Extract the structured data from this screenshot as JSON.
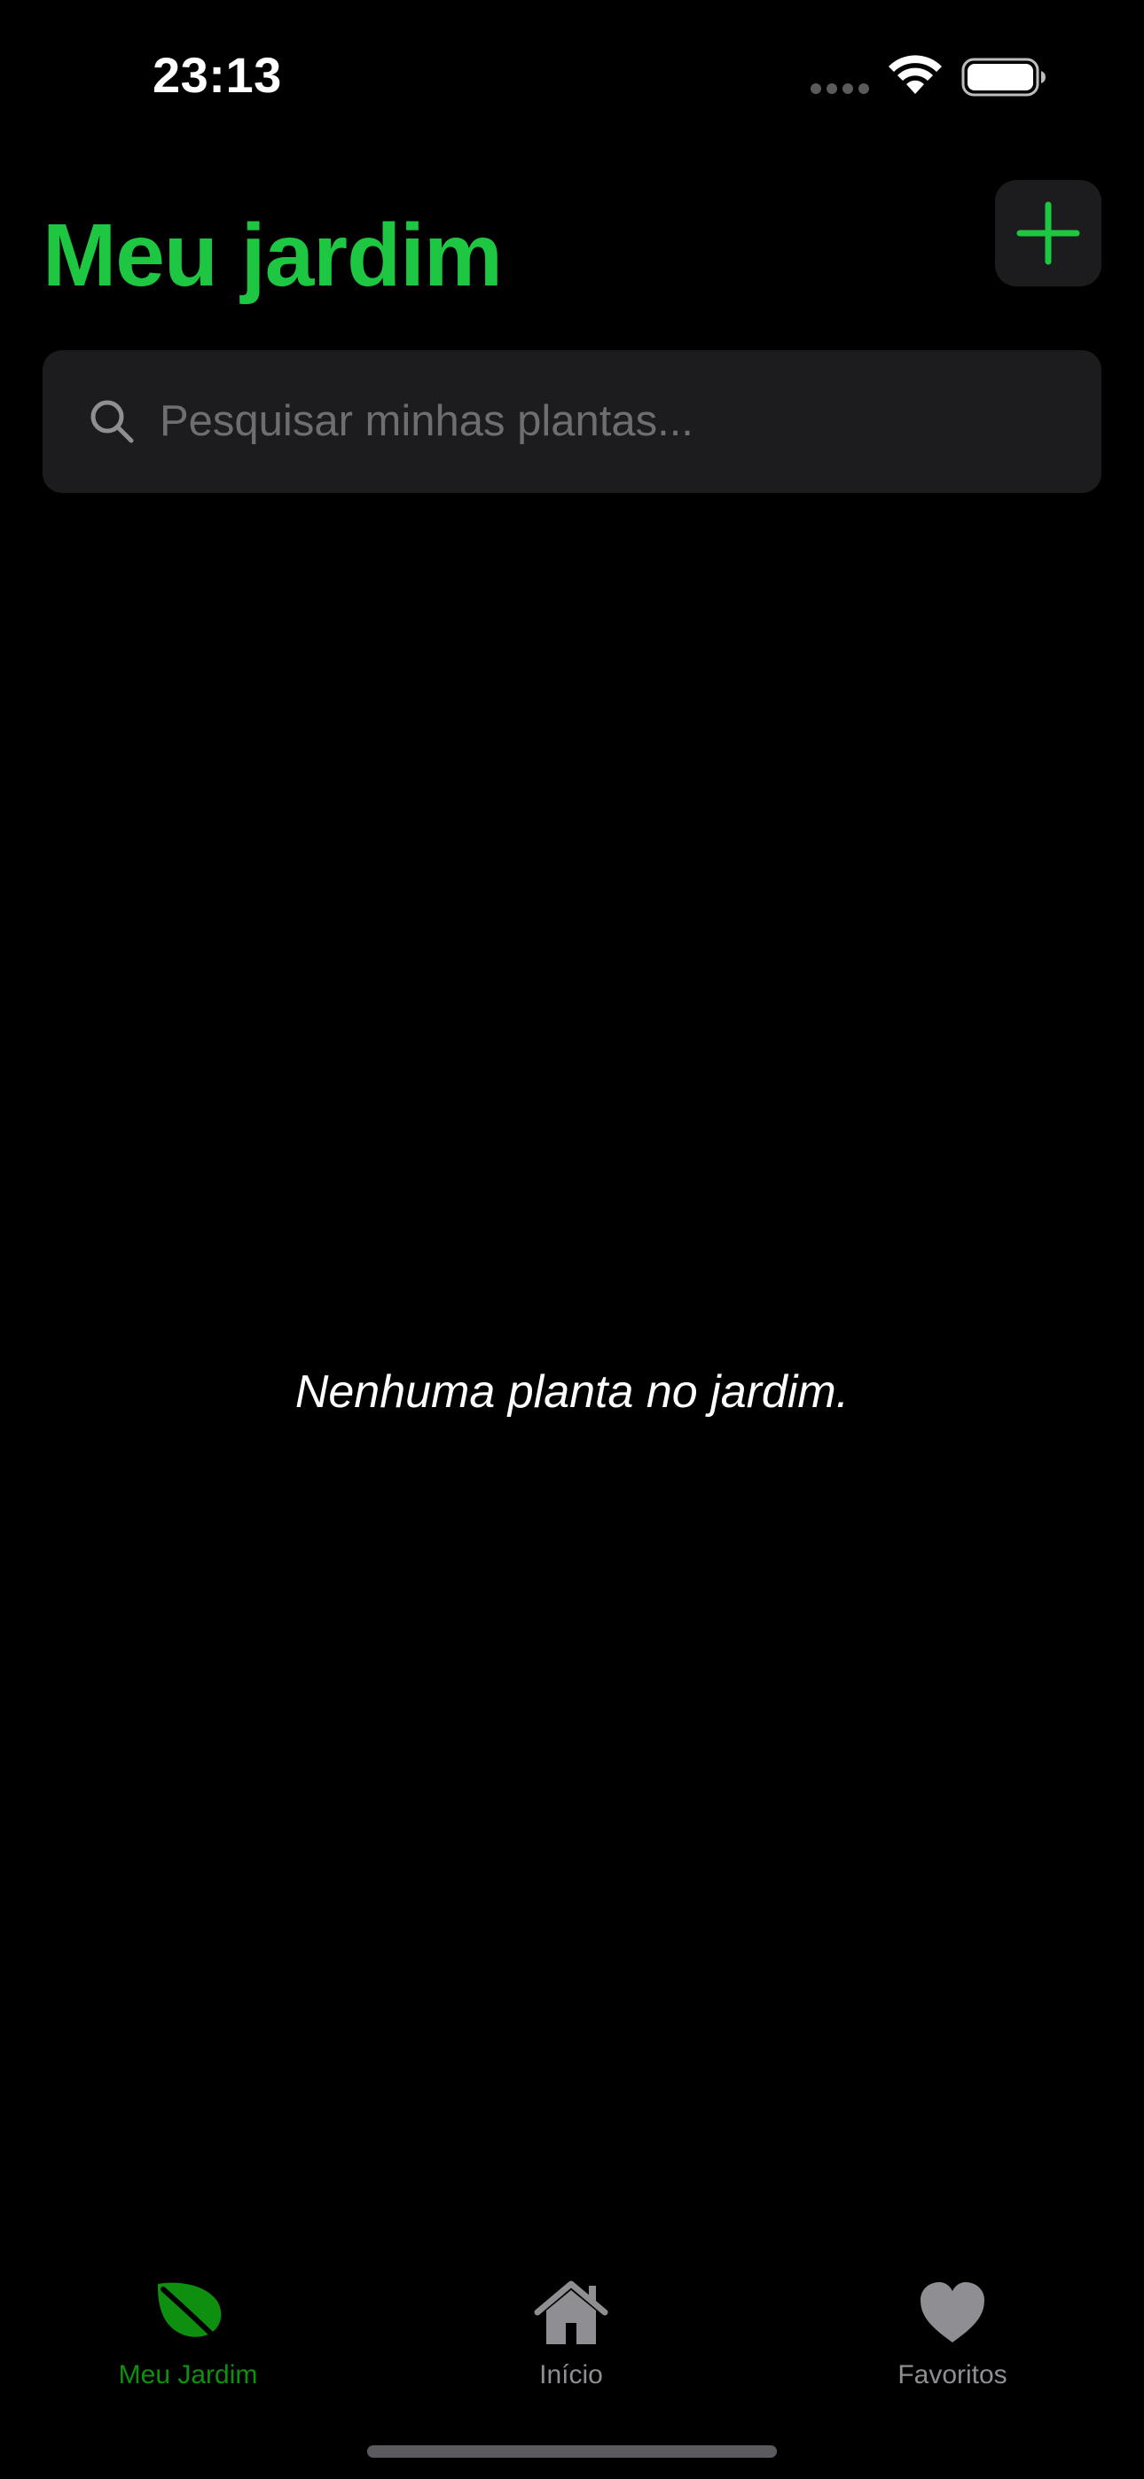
{
  "status_bar": {
    "time": "23:13",
    "icons": [
      "cellular-signal-icon",
      "wifi-icon",
      "battery-icon"
    ]
  },
  "header": {
    "title": "Meu jardim",
    "add_button_icon": "plus-icon"
  },
  "search": {
    "placeholder": "Pesquisar minhas plantas...",
    "value": "",
    "icon": "search-icon"
  },
  "main": {
    "empty_message": "Nenhuma planta no jardim."
  },
  "tab_bar": {
    "items": [
      {
        "label": "Meu Jardim",
        "icon": "leaf-icon",
        "active": true
      },
      {
        "label": "Início",
        "icon": "house-icon",
        "active": false
      },
      {
        "label": "Favoritos",
        "icon": "heart-icon",
        "active": false
      }
    ]
  },
  "colors": {
    "accent": "#1ec742",
    "active_tab": "#0f8f0f",
    "inactive_tab": "#8e8e93",
    "background": "#000000",
    "surface": "#1c1c1e"
  }
}
